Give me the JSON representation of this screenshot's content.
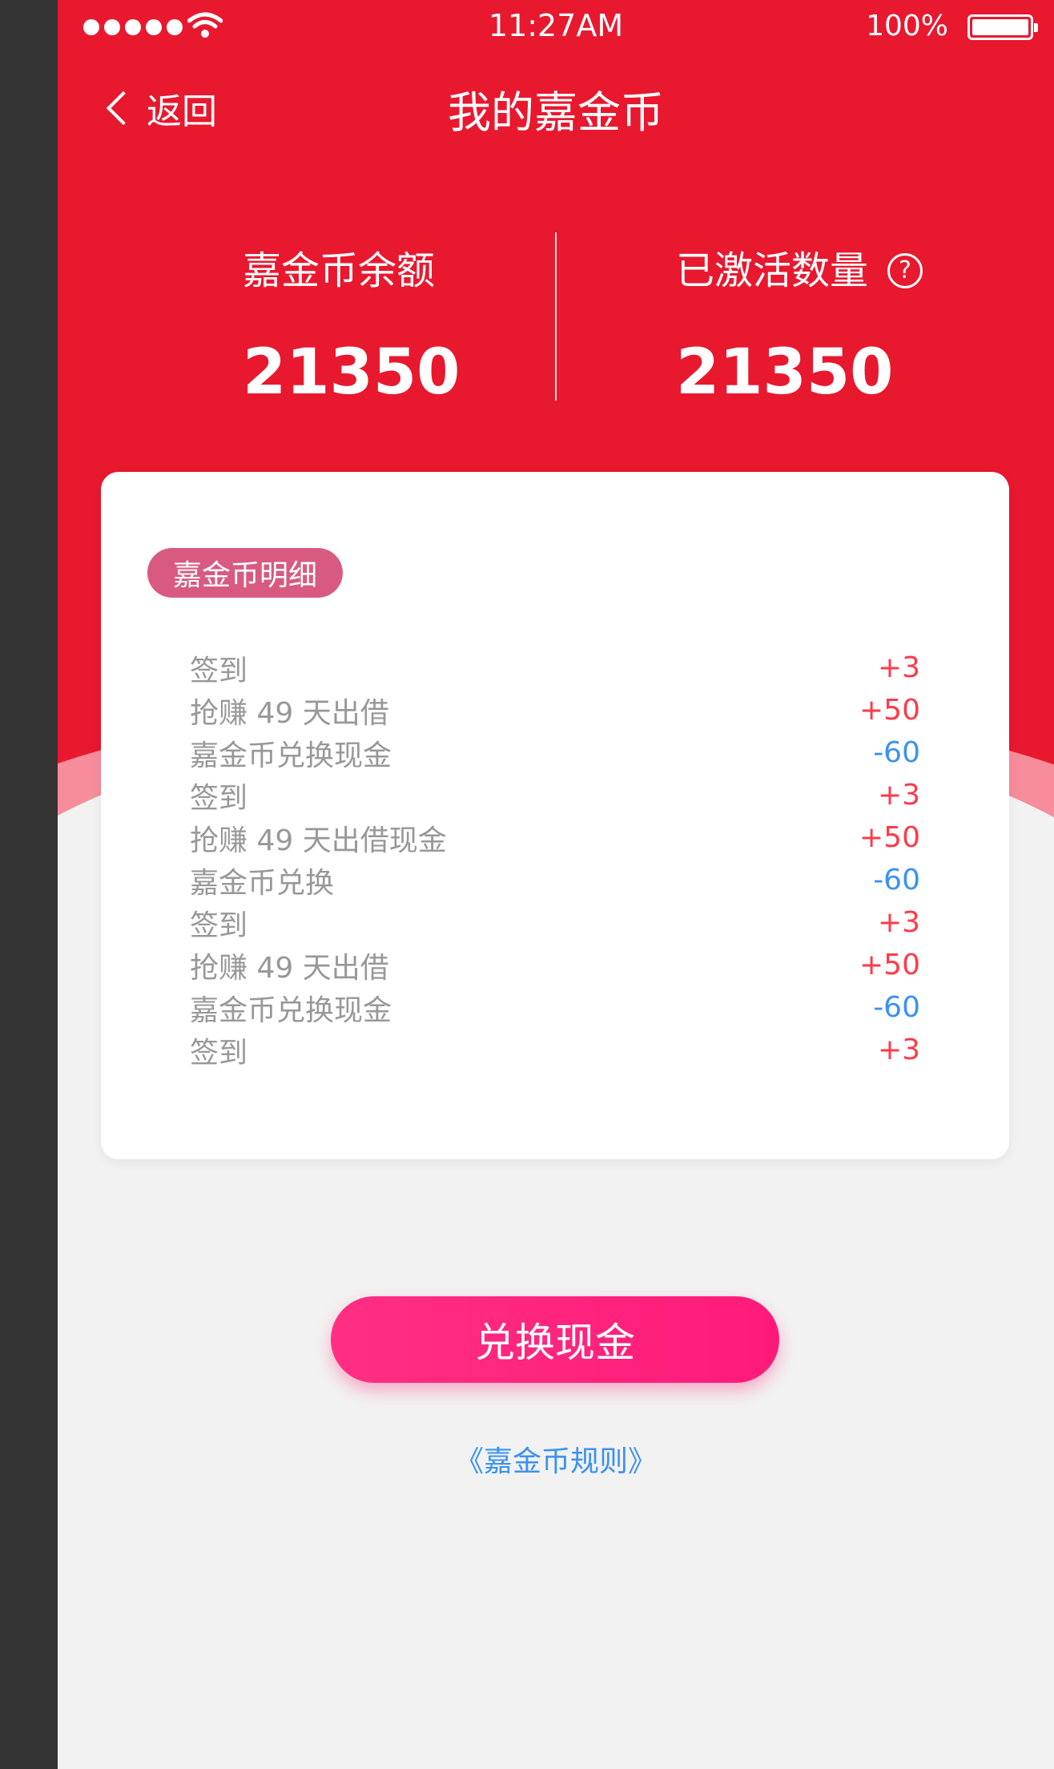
{
  "status_bar": {
    "time": "11:27AM",
    "battery": "100%"
  },
  "nav": {
    "back_label": "返回",
    "title": "我的嘉金币"
  },
  "stats": {
    "balance_label": "嘉金币余额",
    "balance_value": "21350",
    "activated_label": "已激活数量",
    "activated_value": "21350",
    "help_icon": "question-circle-icon",
    "help_glyph": "?"
  },
  "details": {
    "title": "嘉金币明细",
    "rows": [
      {
        "desc": "签到",
        "pts": "+3"
      },
      {
        "desc": "抢赚 49 天出借",
        "pts": "+50"
      },
      {
        "desc": "嘉金币兑换现金",
        "pts": "-60"
      },
      {
        "desc": "签到",
        "pts": "+3"
      },
      {
        "desc": "抢赚 49 天出借现金",
        "pts": "+50"
      },
      {
        "desc": "嘉金币兑换",
        "pts": "-60"
      },
      {
        "desc": "签到",
        "pts": "+3"
      },
      {
        "desc": "抢赚 49 天出借",
        "pts": "+50"
      },
      {
        "desc": "嘉金币兑换现金",
        "pts": "-60"
      },
      {
        "desc": "签到",
        "pts": "+3"
      }
    ]
  },
  "actions": {
    "exchange_label": "兑换现金",
    "rules_label": "《嘉金币规则》"
  },
  "colors": {
    "header_red": "#e8182f",
    "positive": "#ff3a49",
    "negative": "#3b92f0",
    "text_gray": "#989898",
    "button_text": "#ffffff",
    "rules_link": "#3b92f0"
  }
}
